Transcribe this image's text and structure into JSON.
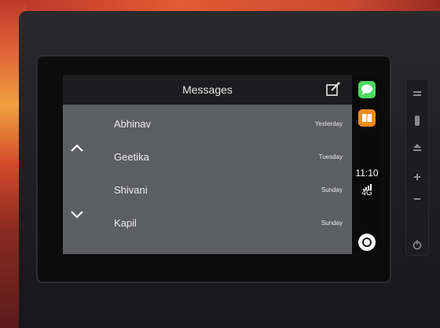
{
  "header": {
    "title": "Messages"
  },
  "conversations": [
    {
      "name": "Abhinav",
      "date": "Yesterday"
    },
    {
      "name": "Geetika",
      "date": "Tuesday"
    },
    {
      "name": "Shivani",
      "date": "Sunday"
    },
    {
      "name": "Kapil",
      "date": "Sunday"
    }
  ],
  "status": {
    "time": "11:10",
    "network": "4G"
  },
  "colors": {
    "messages_app": "#4cd964",
    "books_app": "#f28c1a",
    "screen_bg": "#5d5e62",
    "header_bg": "#1c1c1e"
  },
  "icons": {
    "compose": "compose-icon",
    "scroll_up": "chevron-up-icon",
    "scroll_down": "chevron-down-icon",
    "home": "home-button-icon"
  }
}
